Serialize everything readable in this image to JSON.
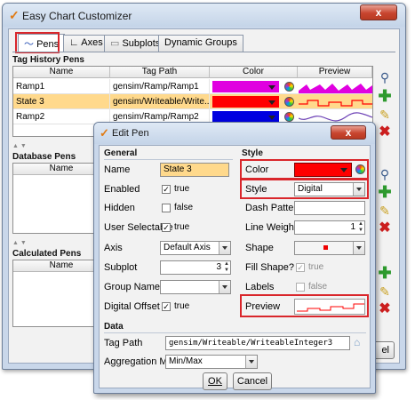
{
  "window": {
    "title": "Easy Chart Customizer",
    "close": "x"
  },
  "tabs": [
    {
      "label": "Pens"
    },
    {
      "label": "Axes"
    },
    {
      "label": "Subplots"
    },
    {
      "label": "Dynamic Groups"
    }
  ],
  "tag_history": {
    "title": "Tag History Pens",
    "columns": [
      "Name",
      "Tag Path",
      "Color",
      "Preview"
    ],
    "rows": [
      {
        "name": "Ramp1",
        "path": "gensim/Ramp/Ramp1",
        "color": "#e000e0"
      },
      {
        "name": "State 3",
        "path": "gensim/Writeable/Write...",
        "color": "#ff0000"
      },
      {
        "name": "Ramp2",
        "path": "gensim/Ramp/Ramp2",
        "color": "#0000e0"
      }
    ]
  },
  "database": {
    "title": "Database Pens",
    "col_name": "Name"
  },
  "calculated": {
    "title": "Calculated Pens",
    "col_name": "Name"
  },
  "main_button_partial": "el",
  "edit_pen": {
    "title": "Edit Pen",
    "close": "x",
    "general_title": "General",
    "style_title": "Style",
    "data_title": "Data",
    "name_label": "Name",
    "name_value": "State 3",
    "enabled_label": "Enabled",
    "enabled_value": "true",
    "hidden_label": "Hidden",
    "hidden_value": "false",
    "user_selectable_label": "User Selectable",
    "user_selectable_value": "true",
    "axis_label": "Axis",
    "axis_value": "Default Axis",
    "subplot_label": "Subplot",
    "subplot_value": "3",
    "group_name_label": "Group Name",
    "group_name_value": "",
    "digital_offset_label": "Digital Offset",
    "digital_offset_value": "true",
    "color_label": "Color",
    "color_value": "#ff0000",
    "style_label": "Style",
    "style_value": "Digital",
    "dash_label": "Dash Pattern",
    "dash_value": "",
    "line_weight_label": "Line Weight",
    "line_weight_value": "1",
    "shape_label": "Shape",
    "fill_shape_label": "Fill Shape?",
    "fill_shape_value": "true",
    "labels_label": "Labels",
    "labels_value": "false",
    "preview_label": "Preview",
    "tag_path_label": "Tag Path",
    "tag_path_value": "gensim/Writeable/WriteableInteger3",
    "aggregation_label": "Aggregation Mode",
    "aggregation_value": "Min/Max",
    "ok_label": "OK",
    "cancel_label": "Cancel"
  },
  "colors": {
    "highlight": "#ffd98c",
    "accent_red": "#d9262b"
  }
}
